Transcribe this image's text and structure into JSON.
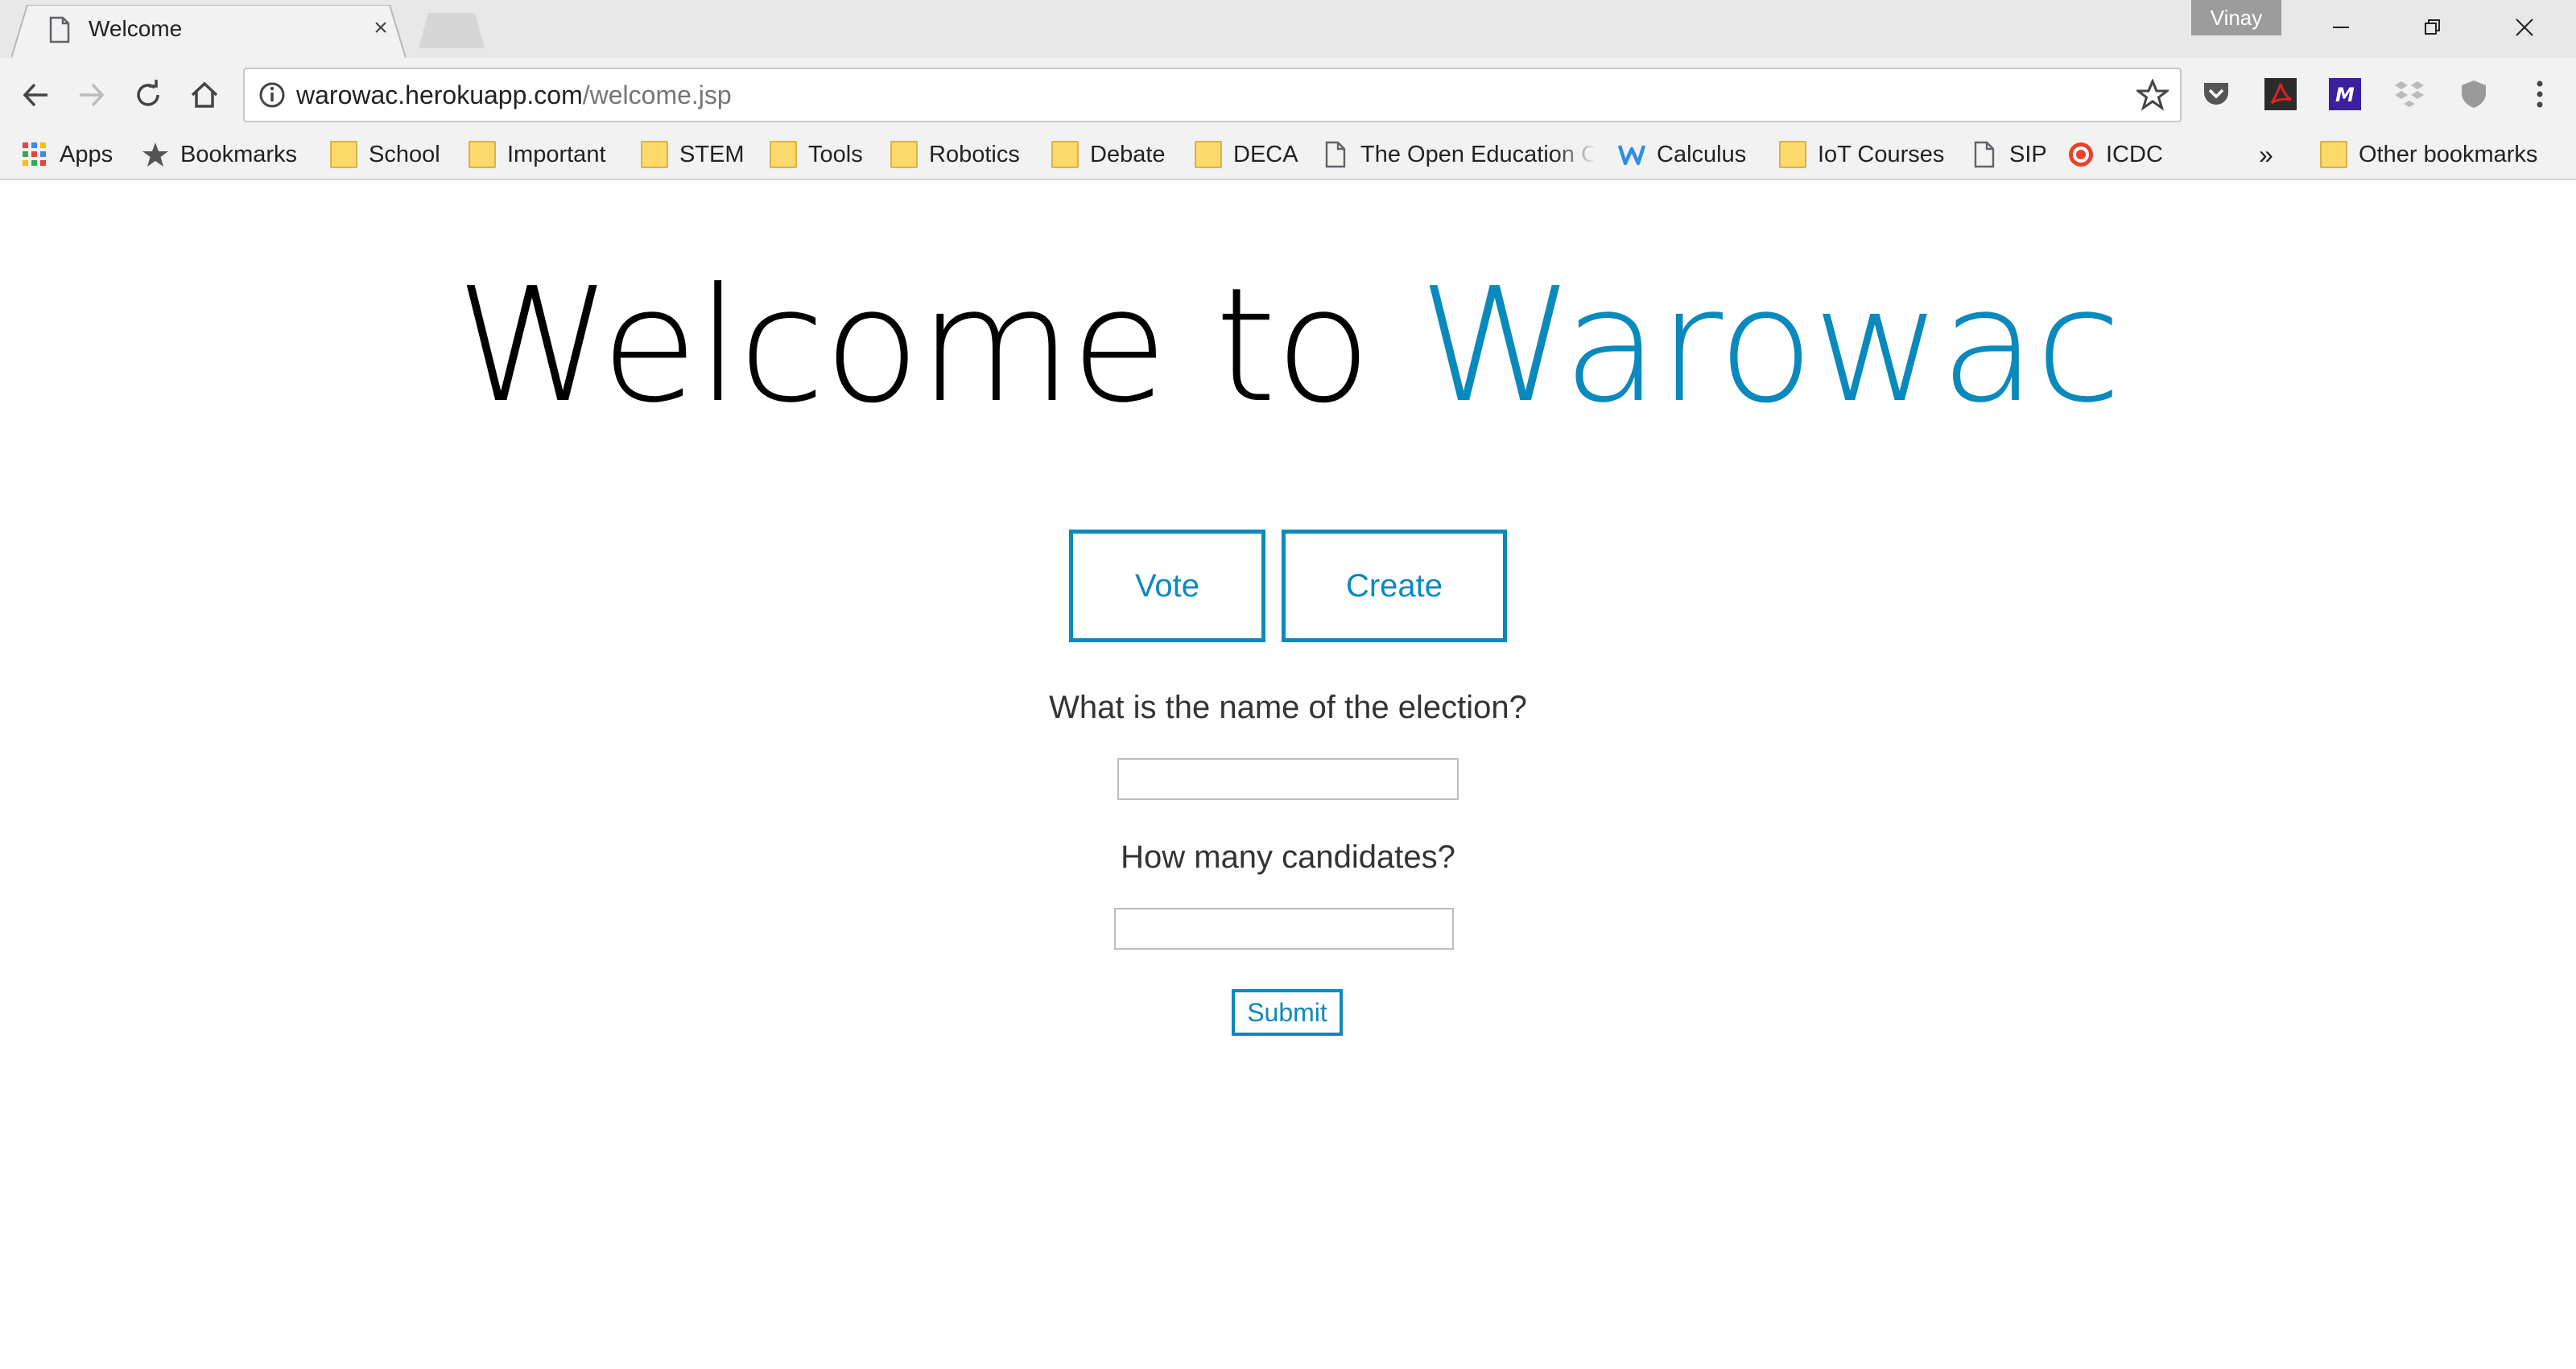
{
  "browser": {
    "tab_title": "Welcome",
    "profile_name": "Vinay",
    "url_host": "warowac.herokuapp.com",
    "url_path": "/welcome.jsp"
  },
  "bookmarks": {
    "items": [
      {
        "label": "Apps",
        "icon": "apps-grid-icon"
      },
      {
        "label": "Bookmarks",
        "icon": "star-icon"
      },
      {
        "label": "School",
        "icon": "folder-icon"
      },
      {
        "label": "Important",
        "icon": "folder-icon"
      },
      {
        "label": "STEM",
        "icon": "folder-icon"
      },
      {
        "label": "Tools",
        "icon": "folder-icon"
      },
      {
        "label": "Robotics",
        "icon": "folder-icon"
      },
      {
        "label": "Debate",
        "icon": "folder-icon"
      },
      {
        "label": "DECA",
        "icon": "folder-icon"
      },
      {
        "label": "The Open Education C",
        "icon": "page-icon"
      },
      {
        "label": "Calculus",
        "icon": "weebly-icon"
      },
      {
        "label": "IoT Courses",
        "icon": "folder-icon"
      },
      {
        "label": "SIP",
        "icon": "page-icon"
      },
      {
        "label": "ICDC",
        "icon": "target-icon"
      }
    ],
    "overflow": "»",
    "other": "Other bookmarks"
  },
  "page": {
    "headline_prefix": "Welcome to ",
    "headline_brand": "Warowac",
    "vote_label": "Vote",
    "create_label": "Create",
    "election_question": "What is the name of the election?",
    "election_value": "",
    "candidates_question": "How many candidates?",
    "candidates_value": "",
    "submit_label": "Submit"
  },
  "colors": {
    "accent": "#0a89bd",
    "chrome_bg": "#f2f2f2",
    "folder": "#fbd96b"
  }
}
